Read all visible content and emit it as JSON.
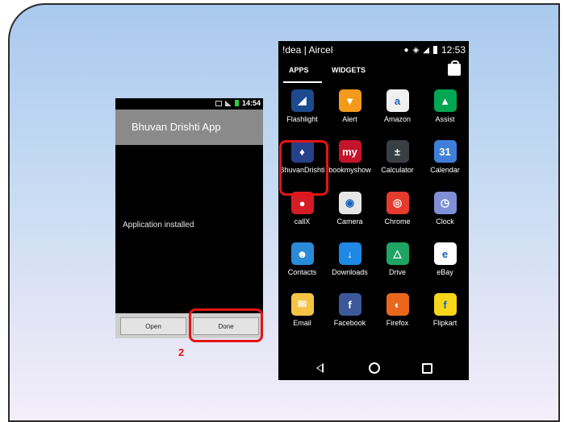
{
  "installer": {
    "app_title": "Bhuvan Drishti App",
    "message": "Application installed",
    "open_label": "Open",
    "done_label": "Done",
    "status_time": "14:54"
  },
  "step_number": "2",
  "launcher": {
    "carrier": "!dea | Aircel",
    "time": "12:53",
    "tabs": [
      "APPS",
      "WIDGETS"
    ],
    "apps": [
      {
        "label": "Flashlight",
        "icon": "flashlight-icon",
        "color": "#1d4a8c",
        "glyph": "◢"
      },
      {
        "label": "Alert",
        "icon": "alert-icon",
        "color": "#f29a1b",
        "glyph": "▼"
      },
      {
        "label": "Amazon",
        "icon": "amazon-icon",
        "color": "#f0f0f0",
        "glyph": "a"
      },
      {
        "label": "Assist",
        "icon": "assist-icon",
        "color": "#00a651",
        "glyph": "▲"
      },
      {
        "label": "BhuvanDrishti",
        "icon": "bhuvan-drishti-icon",
        "color": "#26408a",
        "glyph": "♦"
      },
      {
        "label": "bookmyshow",
        "icon": "bookmyshow-icon",
        "color": "#c4142b",
        "glyph": "my"
      },
      {
        "label": "Calculator",
        "icon": "calculator-icon",
        "color": "#3a3f44",
        "glyph": "±"
      },
      {
        "label": "Calendar",
        "icon": "calendar-icon",
        "color": "#3f7fd9",
        "glyph": "31"
      },
      {
        "label": "callX",
        "icon": "callx-icon",
        "color": "#d41c24",
        "glyph": "●"
      },
      {
        "label": "Camera",
        "icon": "camera-icon",
        "color": "#e6e6e6",
        "glyph": "◉"
      },
      {
        "label": "Chrome",
        "icon": "chrome-icon",
        "color": "#e43b2e",
        "glyph": "◎"
      },
      {
        "label": "Clock",
        "icon": "clock-icon",
        "color": "#7f8fd6",
        "glyph": "◷"
      },
      {
        "label": "Contacts",
        "icon": "contacts-icon",
        "color": "#2a8bd8",
        "glyph": "☻"
      },
      {
        "label": "Downloads",
        "icon": "downloads-icon",
        "color": "#1e88e5",
        "glyph": "↓"
      },
      {
        "label": "Drive",
        "icon": "drive-icon",
        "color": "#1fa463",
        "glyph": "△"
      },
      {
        "label": "eBay",
        "icon": "ebay-icon",
        "color": "#ffffff",
        "glyph": "e"
      },
      {
        "label": "Email",
        "icon": "email-icon",
        "color": "#f6c445",
        "glyph": "✉"
      },
      {
        "label": "Facebook",
        "icon": "facebook-icon",
        "color": "#3b5998",
        "glyph": "f"
      },
      {
        "label": "Firefox",
        "icon": "firefox-icon",
        "color": "#e8671c",
        "glyph": "◐"
      },
      {
        "label": "Flipkart",
        "icon": "flipkart-icon",
        "color": "#f9d61a",
        "glyph": "f"
      }
    ]
  }
}
